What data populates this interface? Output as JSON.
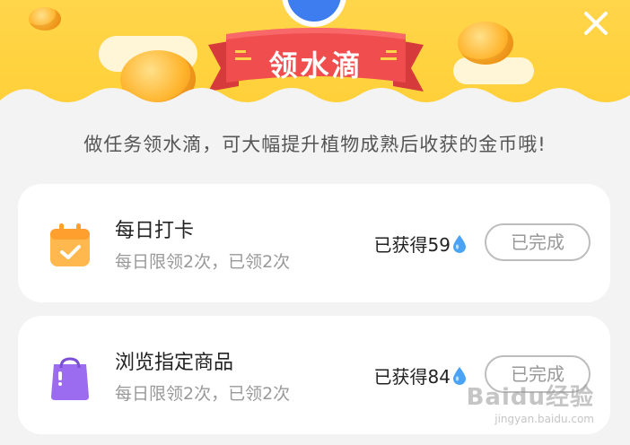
{
  "header": {
    "title": "领水滴",
    "close_icon": "close-icon",
    "colors": {
      "background": "#ffd54a",
      "banner": "#ee4a4a"
    }
  },
  "subtitle": "做任务领水滴，可大幅提升植物成熟后收获的金币哦!",
  "tasks": [
    {
      "title": "每日打卡",
      "subtitle": "每日限领2次，已领2次",
      "earned_label": "已获得59",
      "button_label": "已完成",
      "icon": "calendar-check-icon",
      "icon_color": "#ffb84d"
    },
    {
      "title": "浏览指定商品",
      "subtitle": "每日限领2次，已领2次",
      "earned_label": "已获得84",
      "button_label": "已完成",
      "icon": "shopping-bag-icon",
      "icon_color": "#9b6cf0"
    }
  ],
  "watermark": {
    "text": "Baidu经验",
    "url": "jingyan.baidu.com"
  }
}
